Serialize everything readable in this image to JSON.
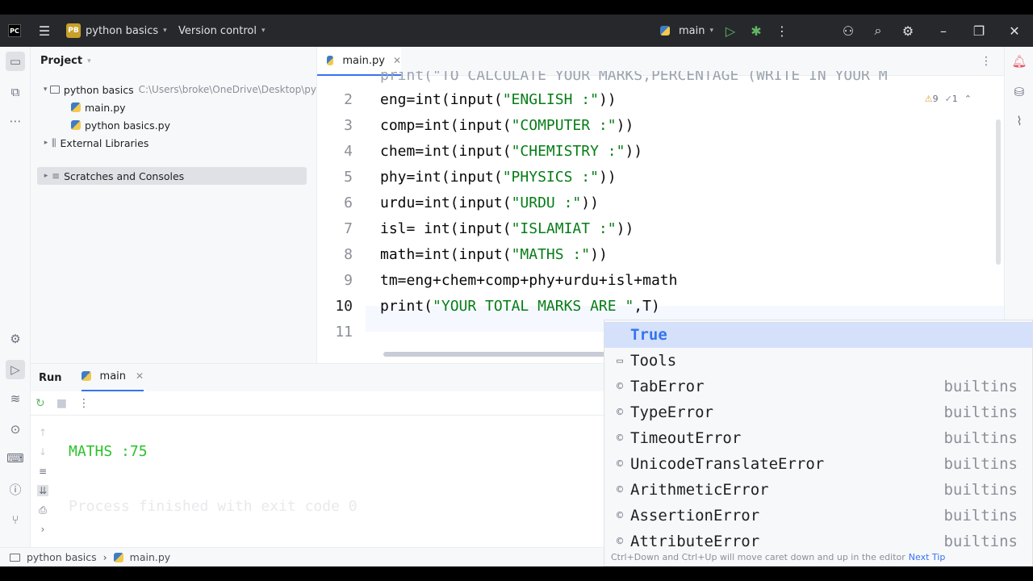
{
  "topbar": {
    "logo": "PC",
    "project_badge": "PB",
    "project_name": "python basics",
    "vcs": "Version control",
    "branch": "main",
    "colors": {
      "bg": "#27282c",
      "run": "#5fb865",
      "debug": "#5fb865"
    }
  },
  "project_panel": {
    "title": "Project",
    "tree": [
      {
        "label": "python basics",
        "path": "C:\\Users\\broke\\OneDrive\\Desktop\\py",
        "type": "folder",
        "expanded": true
      },
      {
        "label": "main.py",
        "type": "python-file"
      },
      {
        "label": "python basics.py",
        "type": "python-file"
      },
      {
        "label": "External Libraries",
        "type": "library"
      },
      {
        "label": "Scratches and Consoles",
        "type": "scratch",
        "selected": true
      }
    ]
  },
  "editor": {
    "tab": "main.py",
    "inspections": {
      "warnings": "9",
      "weak": "1"
    },
    "line_numbers": [
      "2",
      "3",
      "4",
      "5",
      "6",
      "7",
      "8",
      "9",
      "10",
      "11"
    ],
    "partial_top_line": "print(\"TO CALCULATE YOUR MARKS,PERCENTAGE (WRITE IN YOUR M",
    "lines": [
      {
        "pre": "eng=int(input(",
        "str": "\"ENGLISH :\"",
        "post": "))"
      },
      {
        "pre": "comp=int(input(",
        "str": "\"COMPUTER :\"",
        "post": "))"
      },
      {
        "pre": "chem=int(input(",
        "str": "\"CHEMISTRY :\"",
        "post": "))"
      },
      {
        "pre": "phy=int(input(",
        "str": "\"PHYSICS :\"",
        "post": "))"
      },
      {
        "pre": "urdu=int(input(",
        "str": "\"URDU :\"",
        "post": "))"
      },
      {
        "pre": "isl= int(input(",
        "str": "\"ISLAMIAT :\"",
        "post": "))"
      },
      {
        "pre": "math=int(input(",
        "str": "\"MATHS :\"",
        "post": "))"
      },
      {
        "pre": "tm=eng+chem+comp+phy+urdu+isl+math",
        "str": "",
        "post": ""
      },
      {
        "pre": "print(",
        "str": "\"YOUR TOTAL MARKS ARE \"",
        "post": ",T)"
      },
      {
        "pre": "",
        "str": "",
        "post": ""
      }
    ]
  },
  "run_panel": {
    "title": "Run",
    "tab": "main",
    "output_line": "MATHS :75",
    "finish_line": "Process finished with exit code 0"
  },
  "completion": {
    "items": [
      {
        "icon": "folder",
        "label": "True",
        "source": ""
      },
      {
        "icon": "folder",
        "label": "Tools",
        "source": ""
      },
      {
        "icon": "class",
        "label": "TabError",
        "source": "builtins"
      },
      {
        "icon": "class",
        "label": "TypeError",
        "source": "builtins"
      },
      {
        "icon": "class",
        "label": "TimeoutError",
        "source": "builtins"
      },
      {
        "icon": "class",
        "label": "UnicodeTranslateError",
        "source": "builtins"
      },
      {
        "icon": "class",
        "label": "ArithmeticError",
        "source": "builtins"
      },
      {
        "icon": "class",
        "label": "AssertionError",
        "source": "builtins"
      },
      {
        "icon": "class",
        "label": "AttributeError",
        "source": "builtins"
      }
    ],
    "hint": "Ctrl+Down and Ctrl+Up will move caret down and up in the editor",
    "hint_link": "Next Tip"
  },
  "statusbar": {
    "crumbs": [
      "python basics",
      "main.py"
    ]
  }
}
